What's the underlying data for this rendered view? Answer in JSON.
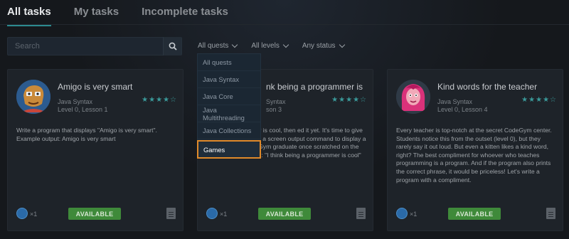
{
  "tabs": [
    {
      "label": "All tasks",
      "active": true
    },
    {
      "label": "My tasks",
      "active": false
    },
    {
      "label": "Incomplete tasks",
      "active": false
    }
  ],
  "search": {
    "placeholder": "Search",
    "icon": "search-icon"
  },
  "filters": {
    "quests": "All quests",
    "levels": "All levels",
    "status": "Any status"
  },
  "quest_dropdown": {
    "items": [
      "All quests",
      "Java Syntax",
      "Java Core",
      "Java Multithreading",
      "Java Collections",
      "Games"
    ],
    "highlighted": "Games"
  },
  "cards": [
    {
      "title": "Amigo is very smart",
      "quest": "Java Syntax",
      "level": "Level 0, Lesson 1",
      "stars": "★★★★☆",
      "description": "Write a program that displays \"Amigo is very smart\". Example output: Amigo is very smart",
      "count": "×1",
      "status": "AVAILABLE"
    },
    {
      "title": "nk being a programmer is",
      "quest": "Syntax",
      "level": "son 3",
      "stars": "★★★★☆",
      "description": "being a programmer is cool, then ed it yet. It's time to give it a try by gram. Use a screen output command to display a phrase that a CodeGym graduate once scratched on the hull of his spaceship: \"I think being a programmer is cool\"",
      "count": "×1",
      "status": "AVAILABLE"
    },
    {
      "title": "Kind words for the teacher",
      "quest": "Java Syntax",
      "level": "Level 0, Lesson 4",
      "stars": "★★★★☆",
      "description": "Every teacher is top-notch at the secret CodeGym center. Students notice this from the outset (level 0), but they rarely say it out loud. But even a kitten likes a kind word, right? The best compliment for whoever who teaches programming is a program. And if the program also prints the correct phrase, it would be priceless! Let's write a program with a compliment.",
      "count": "×1",
      "status": "AVAILABLE"
    }
  ],
  "colors": {
    "accent": "#2c8a8f",
    "available": "#3f8a3a",
    "highlight": "#e08a2a",
    "star": "#3a9a9a"
  }
}
